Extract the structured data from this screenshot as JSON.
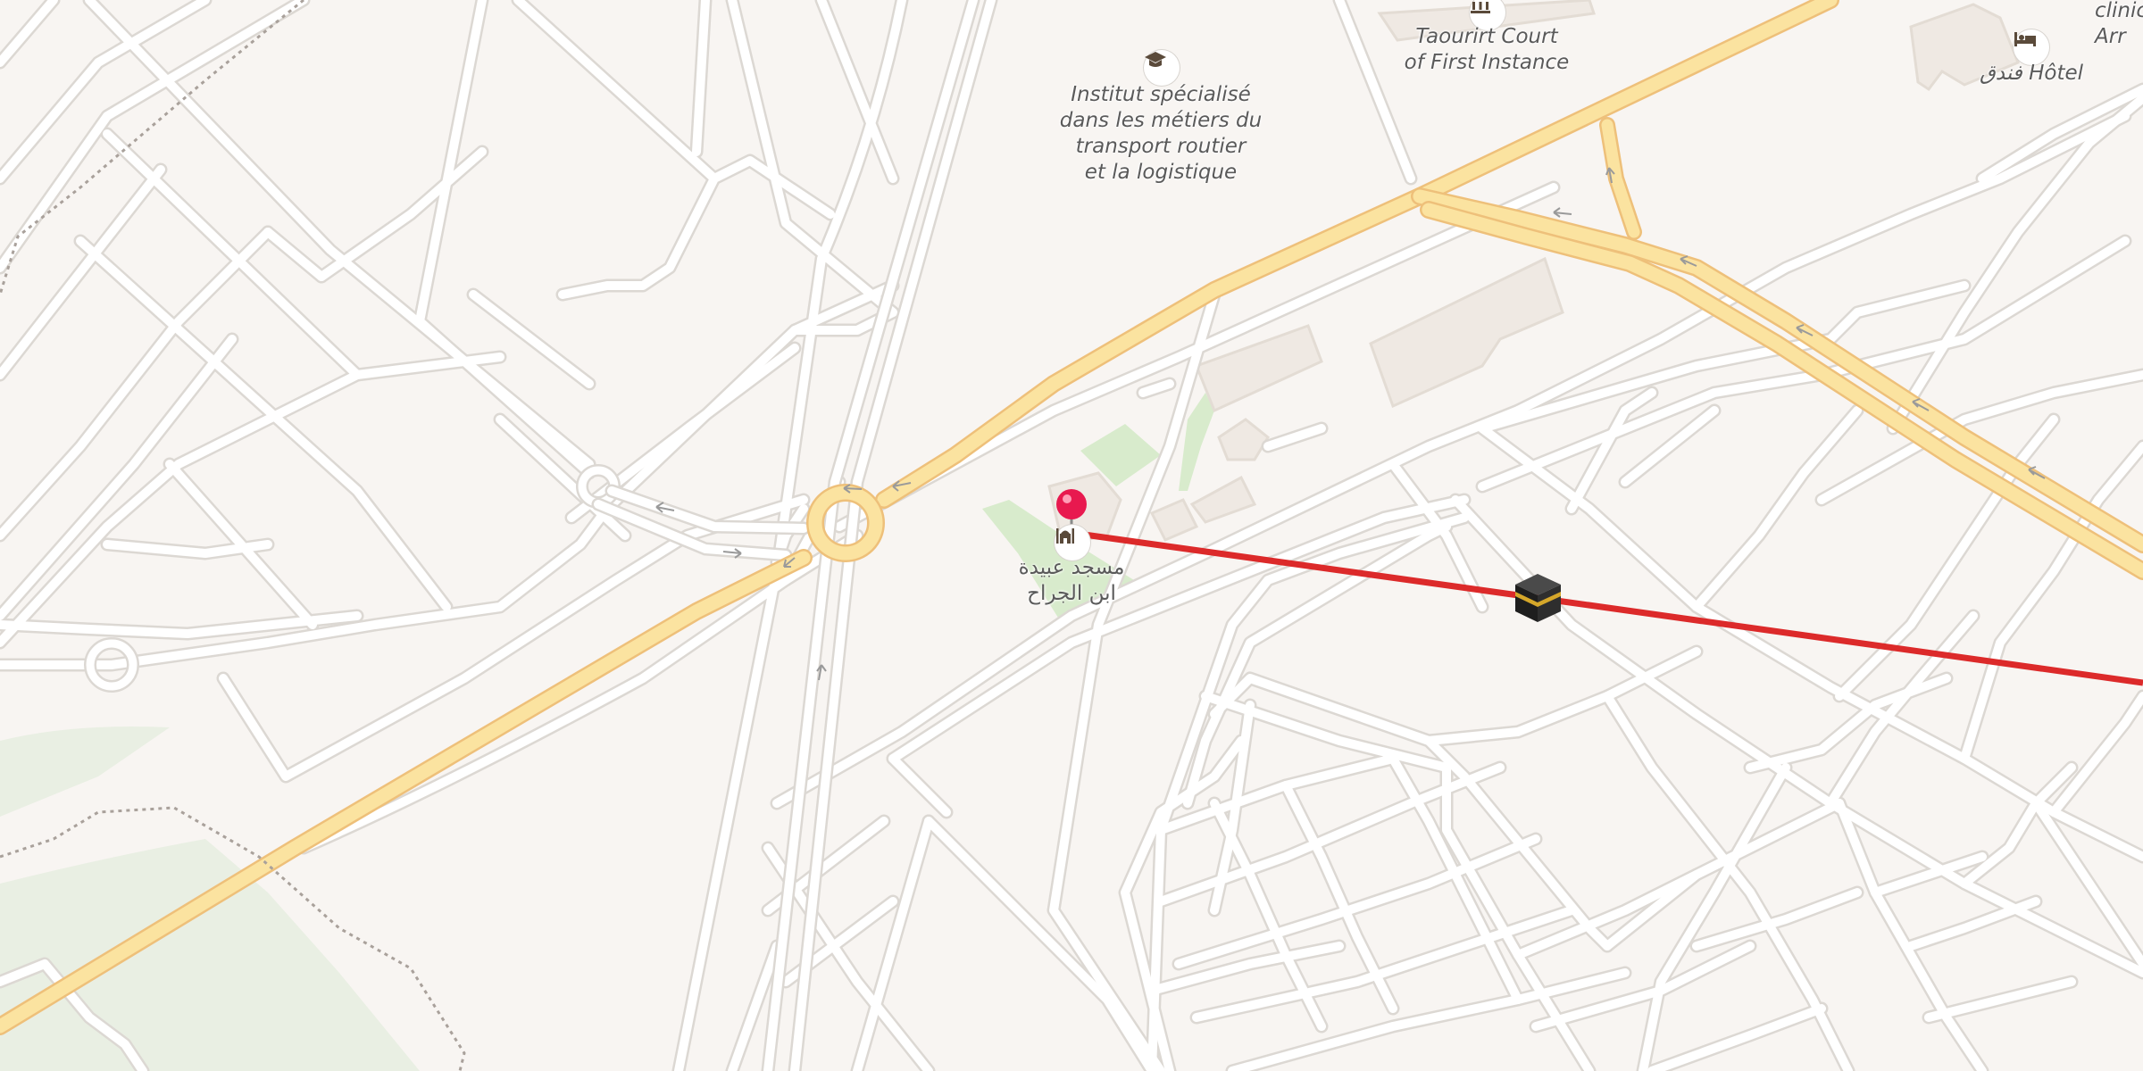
{
  "map": {
    "labels": {
      "institute": [
        "Institut spécialisé",
        "dans les métiers du",
        "transport routier",
        "et la logistique"
      ],
      "court": [
        "Taourirt Court",
        "of First Instance"
      ],
      "hotel": "فندق Hôtel",
      "clinic": [
        "clinic",
        "Arr"
      ],
      "mosque": [
        "مسجد عبيدة",
        "ابن الجراح"
      ]
    },
    "markers": {
      "pin_icon": "map-pin-icon",
      "destination_icon": "kaaba-icon",
      "route_color": "#dc2a2a",
      "pin_color": "#e8194f"
    },
    "colors": {
      "background": "#f8f5f2",
      "road": "#ffffff",
      "road_casing": "#dcd8d3",
      "major_road": "#fbe3a0",
      "major_road_casing": "#eec07a",
      "building": "#efe9e3",
      "park": "#d9eccd",
      "woodland": "#e6ede0"
    }
  }
}
